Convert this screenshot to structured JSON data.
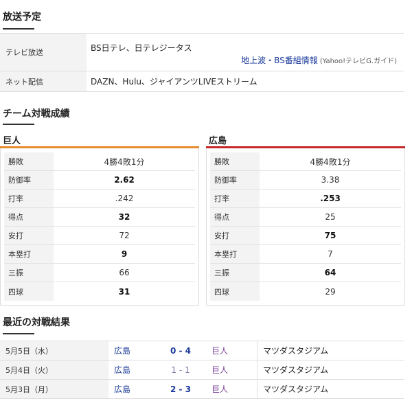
{
  "broadcast": {
    "title": "放送予定",
    "tv_label": "テレビ放送",
    "tv_channels": "BS日テレ、日テレジータス",
    "tv_guide_link": "地上波・BS番組情報",
    "tv_guide_source": "(Yahoo!テレビG.ガイド)",
    "net_label": "ネット配信",
    "net_services": "DAZN、Hulu、ジャイアンツLIVEストリーム"
  },
  "team_stats": {
    "title": "チーム対戦成績",
    "colors": {
      "giants": "#e88a2e",
      "carp": "#c62828"
    },
    "giants": {
      "name": "巨人",
      "rows": [
        {
          "label": "勝敗",
          "value": "4勝4敗1分",
          "bold": false
        },
        {
          "label": "防御率",
          "value": "2.62",
          "bold": true
        },
        {
          "label": "打率",
          "value": ".242",
          "bold": false
        },
        {
          "label": "得点",
          "value": "32",
          "bold": true
        },
        {
          "label": "安打",
          "value": "72",
          "bold": false
        },
        {
          "label": "本塁打",
          "value": "9",
          "bold": true
        },
        {
          "label": "三振",
          "value": "66",
          "bold": false
        },
        {
          "label": "四球",
          "value": "31",
          "bold": true
        }
      ]
    },
    "carp": {
      "name": "広島",
      "rows": [
        {
          "label": "勝敗",
          "value": "4勝4敗1分",
          "bold": false
        },
        {
          "label": "防御率",
          "value": "3.38",
          "bold": false
        },
        {
          "label": "打率",
          "value": ".253",
          "bold": true
        },
        {
          "label": "得点",
          "value": "25",
          "bold": false
        },
        {
          "label": "安打",
          "value": "75",
          "bold": true
        },
        {
          "label": "本塁打",
          "value": "7",
          "bold": false
        },
        {
          "label": "三振",
          "value": "64",
          "bold": true
        },
        {
          "label": "四球",
          "value": "29",
          "bold": false
        }
      ]
    }
  },
  "results": {
    "title": "最近の対戦結果",
    "rows": [
      {
        "date": "5月5日（水）",
        "home": "広島",
        "score": "0 - 4",
        "away": "巨人",
        "stadium": "マツダスタジアム"
      },
      {
        "date": "5月4日（火）",
        "home": "広島",
        "score": "1 - 1",
        "away": "巨人",
        "stadium": "マツダスタジアム"
      },
      {
        "date": "5月3日（月）",
        "home": "広島",
        "score": "2 - 3",
        "away": "巨人",
        "stadium": "マツダスタジアム"
      }
    ]
  }
}
